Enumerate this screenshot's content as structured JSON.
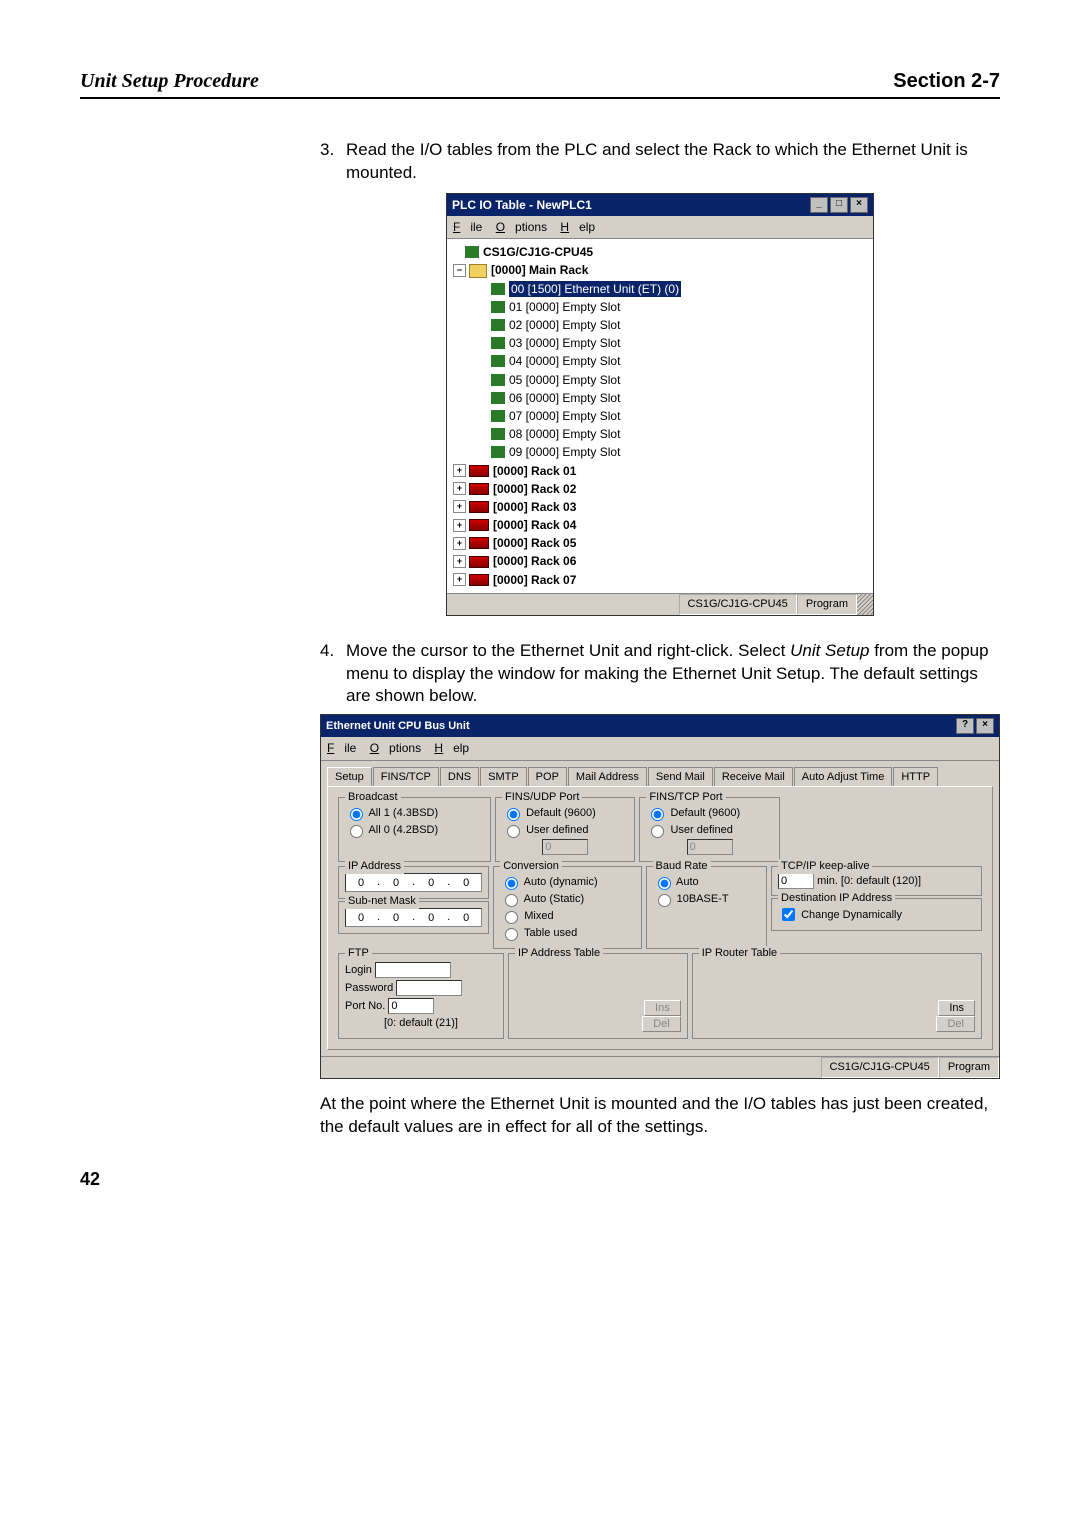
{
  "header": {
    "left": "Unit Setup Procedure",
    "right": "Section 2-7"
  },
  "step3": {
    "num": "3.",
    "text": "Read the I/O tables from the PLC and select the Rack to which the Ethernet Unit is mounted."
  },
  "win1": {
    "title": "PLC IO Table - NewPLC1",
    "menu": [
      "File",
      "Options",
      "Help"
    ],
    "cpu": "CS1G/CJ1G-CPU45",
    "main_rack": "[0000] Main Rack",
    "slot0": "00 [1500] Ethernet Unit (ET) (0)",
    "slots": [
      "01 [0000] Empty Slot",
      "02 [0000] Empty Slot",
      "03 [0000] Empty Slot",
      "04 [0000] Empty Slot",
      "05 [0000] Empty Slot",
      "06 [0000] Empty Slot",
      "07 [0000] Empty Slot",
      "08 [0000] Empty Slot",
      "09 [0000] Empty Slot"
    ],
    "racks": [
      "[0000] Rack 01",
      "[0000] Rack 02",
      "[0000] Rack 03",
      "[0000] Rack 04",
      "[0000] Rack 05",
      "[0000] Rack 06",
      "[0000] Rack 07"
    ],
    "status1": "CS1G/CJ1G-CPU45",
    "status2": "Program"
  },
  "step4": {
    "num": "4.",
    "text_a": "Move the cursor to the Ethernet Unit and right-click. Select ",
    "text_em": "Unit Setup",
    "text_b": " from the popup menu to display the window for making the Ethernet Unit Setup. The default settings are shown below."
  },
  "win2": {
    "title": "Ethernet Unit CPU Bus Unit",
    "menu": [
      "File",
      "Options",
      "Help"
    ],
    "tabs": [
      "Setup",
      "FINS/TCP",
      "DNS",
      "SMTP",
      "POP",
      "Mail Address",
      "Send Mail",
      "Receive Mail",
      "Auto Adjust Time",
      "HTTP"
    ],
    "broadcast": {
      "legend": "Broadcast",
      "opt1": "All 1 (4.3BSD)",
      "opt2": "All 0 (4.2BSD)"
    },
    "finsudp": {
      "legend": "FINS/UDP Port",
      "opt1": "Default (9600)",
      "opt2": "User defined",
      "val": "0"
    },
    "finstcp": {
      "legend": "FINS/TCP Port",
      "opt1": "Default (9600)",
      "opt2": "User defined",
      "val": "0"
    },
    "ip": {
      "legend": "IP Address",
      "v": [
        "0",
        "0",
        "0",
        "0"
      ]
    },
    "subnet": {
      "legend": "Sub-net Mask",
      "v": [
        "0",
        "0",
        "0",
        "0"
      ]
    },
    "conv": {
      "legend": "Conversion",
      "opts": [
        "Auto (dynamic)",
        "Auto (Static)",
        "Mixed",
        "Table used"
      ]
    },
    "baud": {
      "legend": "Baud Rate",
      "opt1": "Auto",
      "opt2": "10BASE-T"
    },
    "keepalive": {
      "legend": "TCP/IP keep-alive",
      "val": "0",
      "suffix": "min.   [0: default (120)]"
    },
    "destip": {
      "legend": "Destination IP Address",
      "chk": "Change Dynamically"
    },
    "ftp": {
      "legend": "FTP",
      "login": "Login",
      "password": "Password",
      "port": "Port No.",
      "portval": "0",
      "hint": "[0: default (21)]"
    },
    "ipaddrtable": {
      "legend": "IP Address Table",
      "ins": "Ins",
      "del": "Del"
    },
    "iproutertable": {
      "legend": "IP Router Table",
      "ins": "Ins",
      "del": "Del"
    },
    "status1": "CS1G/CJ1G-CPU45",
    "status2": "Program"
  },
  "tail": "At the point where the Ethernet Unit is mounted and the I/O tables has just been created, the default values are in effect for all of the settings.",
  "page_number": "42"
}
